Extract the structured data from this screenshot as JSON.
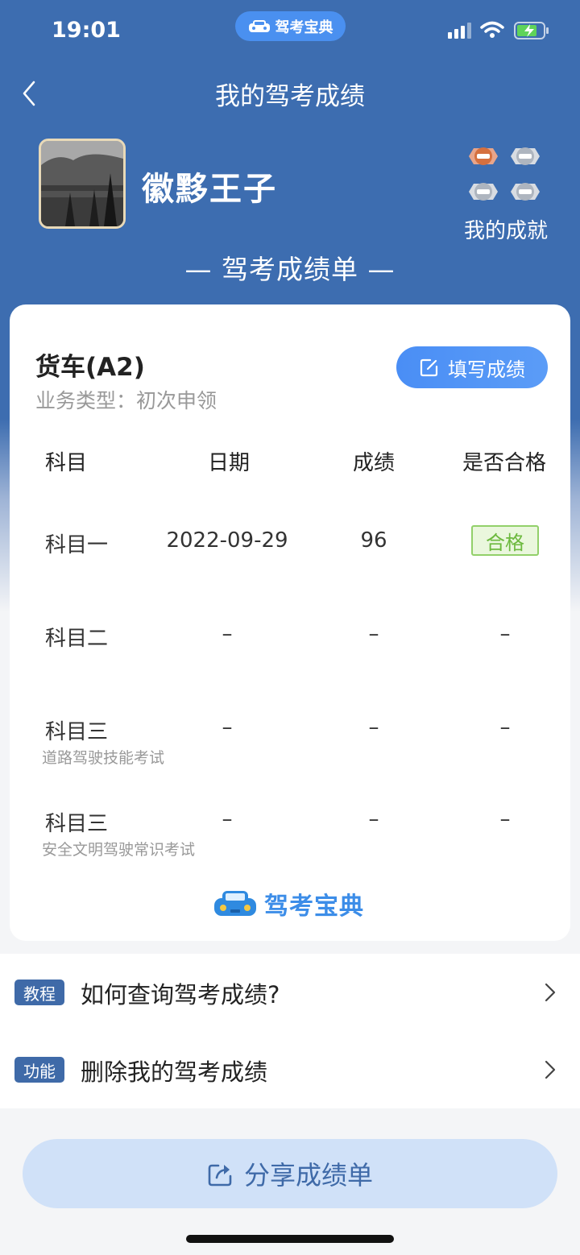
{
  "status_bar": {
    "time": "19:01",
    "app_pill": "驾考宝典"
  },
  "nav": {
    "title": "我的驾考成绩"
  },
  "profile": {
    "username": "徽黟王子",
    "achievements_label": "我的成就"
  },
  "sheet_title": "— 驾考成绩单 —",
  "card": {
    "vehicle": "货车(A2)",
    "business_type": "业务类型：初次申领",
    "fill_button": "填写成绩",
    "columns": [
      "科目",
      "日期",
      "成绩",
      "是否合格"
    ],
    "rows": [
      {
        "subject": "科目一",
        "subtitle": "",
        "date": "2022-09-29",
        "score": "96",
        "pass": "合格"
      },
      {
        "subject": "科目二",
        "subtitle": "",
        "date": "–",
        "score": "–",
        "pass": "–"
      },
      {
        "subject": "科目三",
        "subtitle": "道路驾驶技能考试",
        "date": "–",
        "score": "–",
        "pass": "–"
      },
      {
        "subject": "科目三",
        "subtitle": "安全文明驾驶常识考试",
        "date": "–",
        "score": "–",
        "pass": "–"
      }
    ],
    "brand": "驾考宝典"
  },
  "links": [
    {
      "tag": "教程",
      "label": "如何查询驾考成绩?"
    },
    {
      "tag": "功能",
      "label": "删除我的驾考成绩"
    }
  ],
  "share_button": "分享成绩单",
  "colors": {
    "header_blue": "#3d6db0",
    "accent_blue": "#4a8ef5",
    "pass_green": "#6cb93e"
  },
  "icons": [
    "back-chevron-icon",
    "signal-icon",
    "wifi-icon",
    "battery-icon",
    "edit-icon",
    "chevron-right-icon",
    "share-icon",
    "car-logo-icon",
    "medal-icon"
  ]
}
